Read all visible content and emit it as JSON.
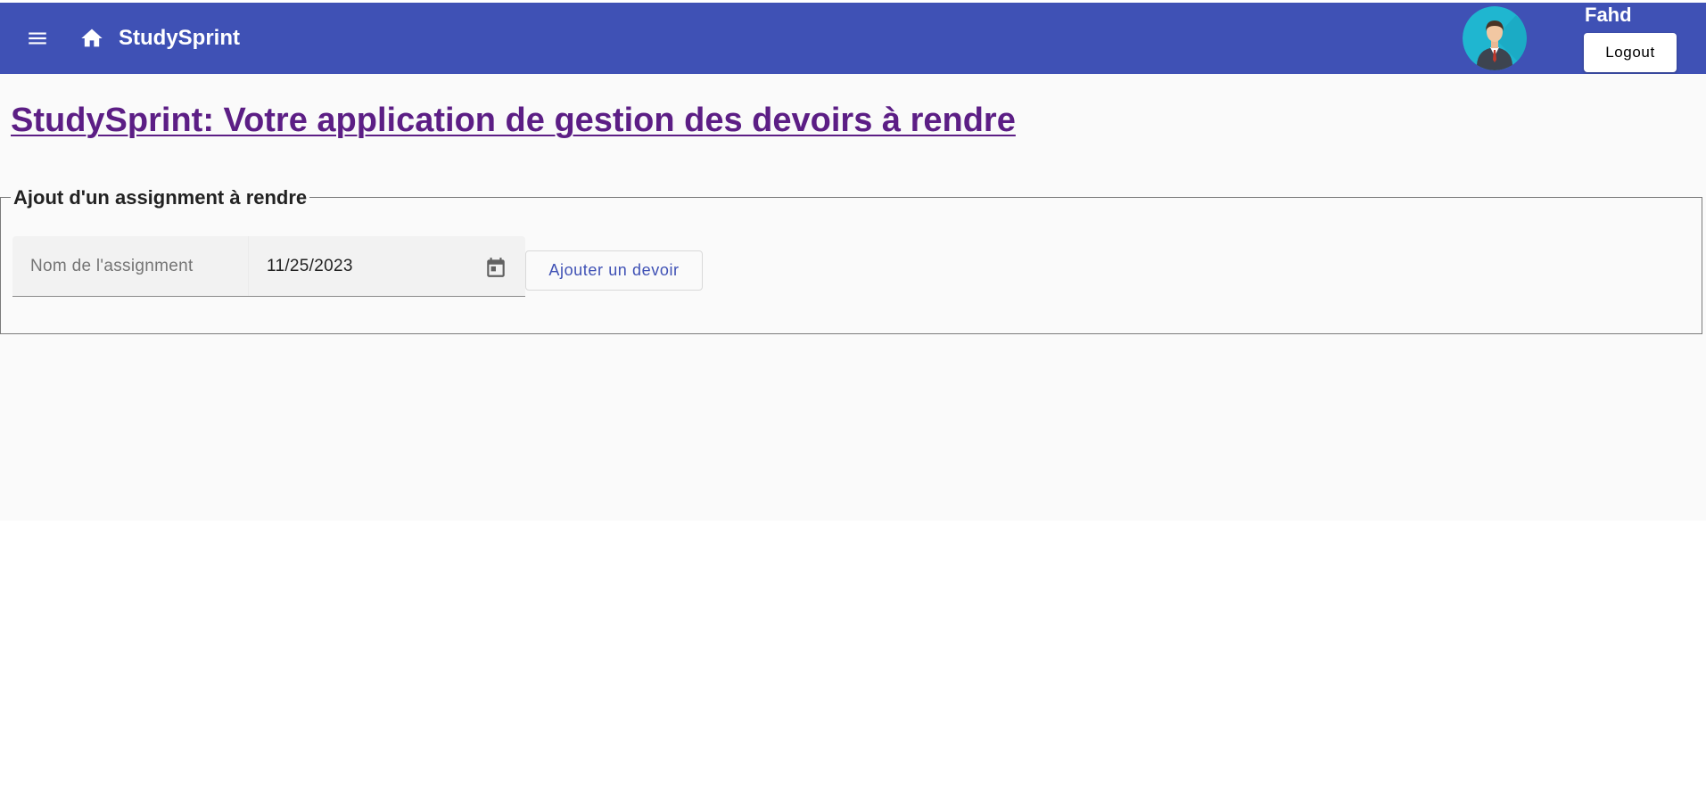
{
  "toolbar": {
    "menu_icon": "menu-icon",
    "home_icon": "home-icon",
    "app_title": "StudySprint",
    "user_name": "Fahd",
    "logout_label": "Logout",
    "background_color": "#3f51b5"
  },
  "main": {
    "page_title": "StudySprint: Votre application de gestion des devoirs à rendre",
    "page_title_color": "#5c1e85",
    "form": {
      "legend": "Ajout d'un assignment à rendre",
      "name_placeholder": "Nom de l'assignment",
      "name_value": "",
      "date_value": "11/25/2023",
      "calendar_icon": "calendar-icon",
      "submit_label": "Ajouter un devoir",
      "submit_color": "#3f51b5"
    }
  }
}
